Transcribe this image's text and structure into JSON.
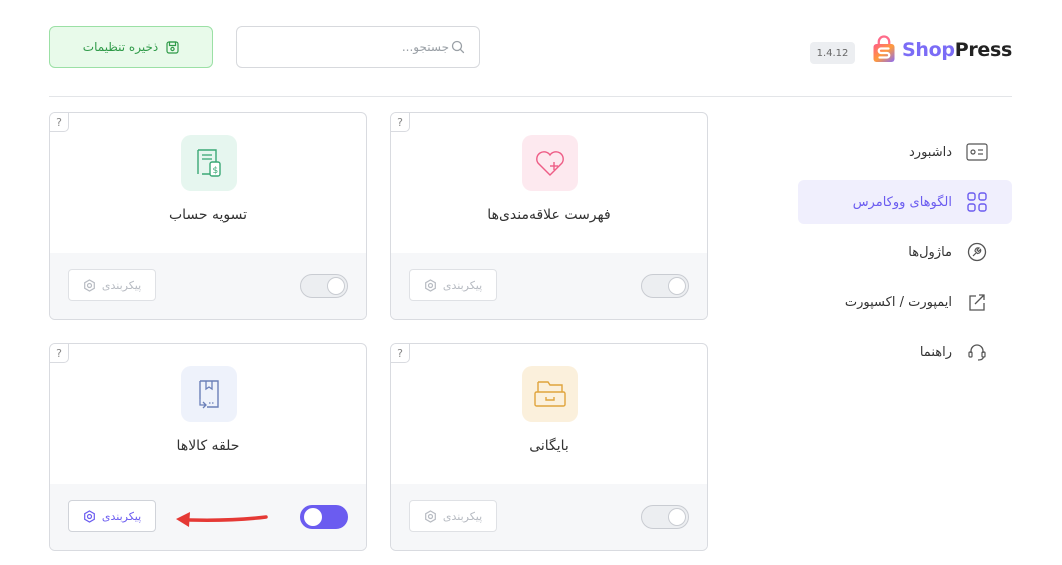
{
  "header": {
    "brand_part1": "Shop",
    "brand_part2": "Press",
    "version": "1.4.12",
    "search_placeholder": "جستجو...",
    "save_label": "ذخیره تنظیمات"
  },
  "sidebar": {
    "items": [
      {
        "label": "داشبورد",
        "icon": "dashboard-icon",
        "active": false
      },
      {
        "label": "الگوهای ووکامرس",
        "icon": "grid-icon",
        "active": true
      },
      {
        "label": "ماژول‌ها",
        "icon": "modules-icon",
        "active": false
      },
      {
        "label": "ایمپورت / اکسپورت",
        "icon": "export-icon",
        "active": false
      },
      {
        "label": "راهنما",
        "icon": "headset-icon",
        "active": false
      }
    ]
  },
  "cards": [
    {
      "title": "فهرست علاقه‌مندی‌ها",
      "icon": "heart-plus-icon",
      "config_label": "پیکربندی",
      "enabled": false,
      "help": "?"
    },
    {
      "title": "تسویه حساب",
      "icon": "invoice-icon",
      "config_label": "پیکربندی",
      "enabled": false,
      "help": "?"
    },
    {
      "title": "بایگانی",
      "icon": "archive-box-icon",
      "config_label": "پیکربندی",
      "enabled": false,
      "help": "?"
    },
    {
      "title": "حلقه کالاها",
      "icon": "product-loop-icon",
      "config_label": "پیکربندی",
      "enabled": true,
      "help": "?"
    }
  ],
  "colors": {
    "accent": "#6b5cf0",
    "save_green": "#2e9a48",
    "annotation_arrow": "#e53935"
  }
}
